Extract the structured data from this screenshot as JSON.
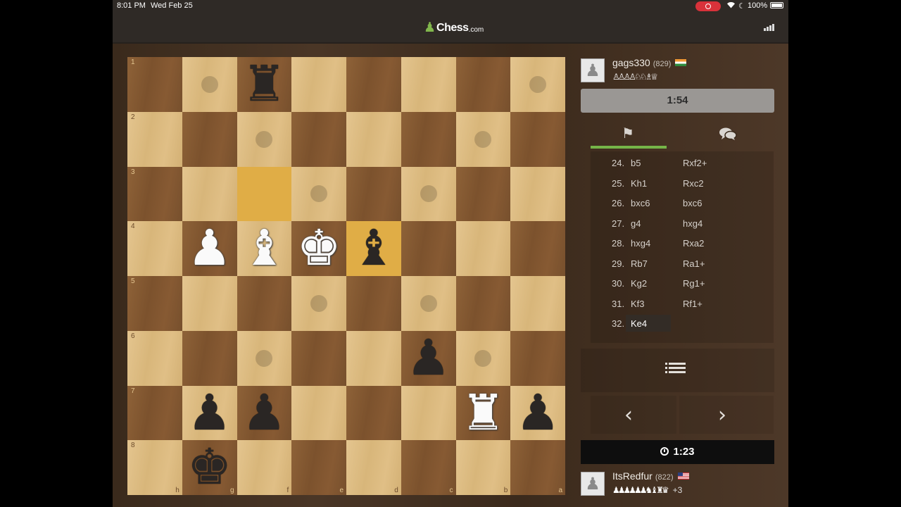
{
  "status_bar": {
    "time": "8:01 PM",
    "date": "Wed Feb 25",
    "battery_pct": "100%",
    "battery_level": 1.0
  },
  "header": {
    "logo_main": "Chess",
    "logo_suffix": ".com"
  },
  "board": {
    "orientation": "black",
    "rank_labels": [
      "1",
      "2",
      "3",
      "4",
      "5",
      "6",
      "7",
      "8"
    ],
    "file_labels": [
      "h",
      "g",
      "f",
      "e",
      "d",
      "c",
      "b",
      "a"
    ],
    "highlighted_squares": [
      "f3",
      "d4"
    ],
    "hint_squares": [
      "g1",
      "a1",
      "f2",
      "b2",
      "e3",
      "c3",
      "e5",
      "c5",
      "f6",
      "b6"
    ],
    "pieces": [
      {
        "square": "f1",
        "type": "rook",
        "color": "black",
        "glyph": "♜"
      },
      {
        "square": "g4",
        "type": "pawn",
        "color": "white",
        "glyph": "♟"
      },
      {
        "square": "f4",
        "type": "bishop",
        "color": "white",
        "glyph": "♝"
      },
      {
        "square": "e4",
        "type": "king",
        "color": "white",
        "glyph": "♚"
      },
      {
        "square": "d4",
        "type": "bishop",
        "color": "black",
        "glyph": "♝"
      },
      {
        "square": "c6",
        "type": "pawn",
        "color": "black",
        "glyph": "♟"
      },
      {
        "square": "g7",
        "type": "pawn",
        "color": "black",
        "glyph": "♟"
      },
      {
        "square": "f7",
        "type": "pawn",
        "color": "black",
        "glyph": "♟"
      },
      {
        "square": "b7",
        "type": "rook",
        "color": "white",
        "glyph": "♜"
      },
      {
        "square": "a7",
        "type": "pawn",
        "color": "black",
        "glyph": "♟"
      },
      {
        "square": "g8",
        "type": "king",
        "color": "black",
        "glyph": "♚"
      }
    ]
  },
  "top_player": {
    "name": "gags330",
    "rating": "(829)",
    "flag": "india",
    "captured": "♙♙♙♙♘♘♗♕",
    "clock": "1:54"
  },
  "bottom_player": {
    "name": "ItsRedfur",
    "rating": "(822)",
    "flag": "usa",
    "captured": "♟♟♟♟♟♟♞♝♜♛",
    "advantage": "+3",
    "clock": "1:23"
  },
  "tabs": {
    "moves_icon": "pawn-flag-icon",
    "chat_icon": "chat-bubbles-icon"
  },
  "moves": [
    {
      "num": "24.",
      "white": "b5",
      "black": "Rxf2+"
    },
    {
      "num": "25.",
      "white": "Kh1",
      "black": "Rxc2"
    },
    {
      "num": "26.",
      "white": "bxc6",
      "black": "bxc6"
    },
    {
      "num": "27.",
      "white": "g4",
      "black": "hxg4"
    },
    {
      "num": "28.",
      "white": "hxg4",
      "black": "Rxa2"
    },
    {
      "num": "29.",
      "white": "Rb7",
      "black": "Ra1+"
    },
    {
      "num": "30.",
      "white": "Kg2",
      "black": "Rg1+"
    },
    {
      "num": "31.",
      "white": "Kf3",
      "black": "Rf1+"
    },
    {
      "num": "32.",
      "white": "Ke4",
      "black": ""
    }
  ],
  "nav": {
    "prev_glyph": "‹",
    "next_glyph": "›",
    "list_icon": "list-icon"
  },
  "colors": {
    "accent_green": "#75b548",
    "highlight": "#e0ad46",
    "recording": "#d8323a"
  }
}
